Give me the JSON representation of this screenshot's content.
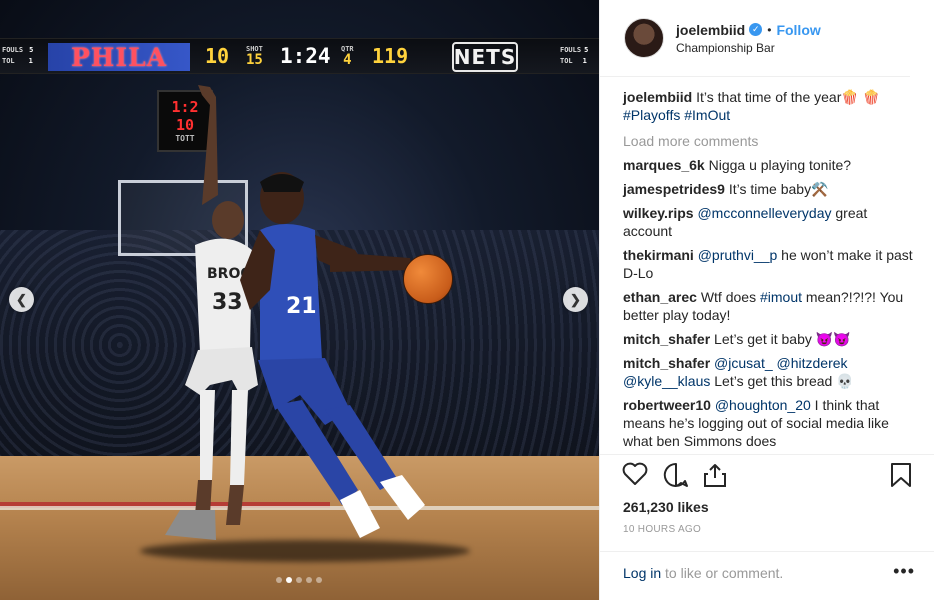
{
  "scoreboard": {
    "home_fouls_label": "FOULS",
    "home_fouls": "5",
    "home_tol_label": "TOL",
    "home_tol": "1",
    "home_team": "PHILA",
    "home_score": "10",
    "shot_label": "SHOT",
    "shot_value": "15",
    "clock": "1:24",
    "qtr_label": "QTR",
    "qtr_value": "4",
    "away_score": "119",
    "away_team": "NETS",
    "away_fouls_label": "FOULS",
    "away_fouls": "5",
    "away_tol_label": "TOL",
    "away_tol": "1"
  },
  "shot_clock": {
    "line1": "1:2",
    "line2": "10",
    "brand": "TOTT"
  },
  "jerseys": {
    "left_name": "BROO",
    "left_number": "33",
    "right_number": "21"
  },
  "carousel": {
    "prev_icon": "chevron-left-icon",
    "next_icon": "chevron-right-icon",
    "dot_count": 5,
    "active_index": 1
  },
  "header": {
    "username": "joelembiid",
    "follow_label": "Follow",
    "separator": "•",
    "location": "Championship Bar"
  },
  "caption": {
    "user": "joelembiid",
    "text": "It’s that time of the year🍿 🍿",
    "tags": [
      "#Playoffs",
      "#ImOut"
    ]
  },
  "load_more": "Load more comments",
  "comments": [
    {
      "user": "marques_6k",
      "parts": [
        {
          "t": "text",
          "v": "Nigga u playing tonite?"
        }
      ]
    },
    {
      "user": "jamespetrides9",
      "parts": [
        {
          "t": "text",
          "v": "It’s time baby⚒️"
        }
      ]
    },
    {
      "user": "wilkey.rips",
      "parts": [
        {
          "t": "tag",
          "v": "@mcconnelleveryday"
        },
        {
          "t": "text",
          "v": " great account"
        }
      ]
    },
    {
      "user": "thekirmani",
      "parts": [
        {
          "t": "tag",
          "v": "@pruthvi__p"
        },
        {
          "t": "text",
          "v": " he won’t make it past D-Lo"
        }
      ]
    },
    {
      "user": "ethan_arec",
      "parts": [
        {
          "t": "text",
          "v": "Wtf does "
        },
        {
          "t": "tag",
          "v": "#imout"
        },
        {
          "t": "text",
          "v": " mean?!?!?! You better play today!"
        }
      ]
    },
    {
      "user": "mitch_shafer",
      "parts": [
        {
          "t": "text",
          "v": "Let’s get it baby 😈😈"
        }
      ]
    },
    {
      "user": "mitch_shafer",
      "parts": [
        {
          "t": "tag",
          "v": "@jcusat_"
        },
        {
          "t": "text",
          "v": " "
        },
        {
          "t": "tag",
          "v": "@hitzderek"
        },
        {
          "t": "text",
          "v": " "
        },
        {
          "t": "tag",
          "v": "@kyle__klaus"
        },
        {
          "t": "text",
          "v": " Let’s get this bread 💀"
        }
      ]
    },
    {
      "user": "robertweer10",
      "parts": [
        {
          "t": "tag",
          "v": "@houghton_20"
        },
        {
          "t": "text",
          "v": " I think that means he’s logging out of social media like what ben Simmons does"
        }
      ]
    }
  ],
  "actions": {
    "like_icon": "heart-icon",
    "comment_icon": "comment-icon",
    "share_icon": "share-icon",
    "save_icon": "bookmark-icon"
  },
  "likes": "261,230 likes",
  "time_ago": "10 HOURS AGO",
  "footer": {
    "login_link": "Log in",
    "login_rest": " to like or comment.",
    "more": "•••"
  }
}
